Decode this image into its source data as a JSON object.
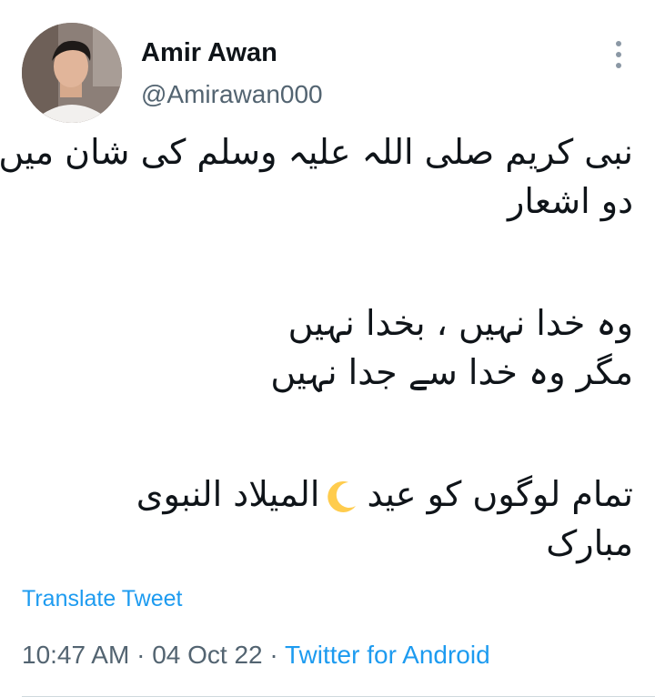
{
  "author": {
    "name": "Amir Awan",
    "handle": "@Amirawan000"
  },
  "tweet": {
    "lines": [
      "نبی کریم صلی اللہ علیہ وسلم کی شان میں",
      "دو اشعار",
      "وہ خدا نہیں ، بخدا نہیں",
      "مگر وہ خدا سے جدا نہیں",
      "تمام لوگوں کو عید",
      "المیلاد النبوی",
      "مبارک"
    ],
    "emoji": "crescent-moon-icon"
  },
  "translate_label": "Translate Tweet",
  "meta": {
    "time": "10:47 AM",
    "separator": "·",
    "date": "04 Oct 22",
    "source": "Twitter for Android"
  },
  "colors": {
    "accent": "#1d9bf0",
    "secondary_text": "#536471",
    "primary_text": "#0f1419"
  },
  "icons": {
    "more": "more-options-icon",
    "avatar": "avatar"
  }
}
